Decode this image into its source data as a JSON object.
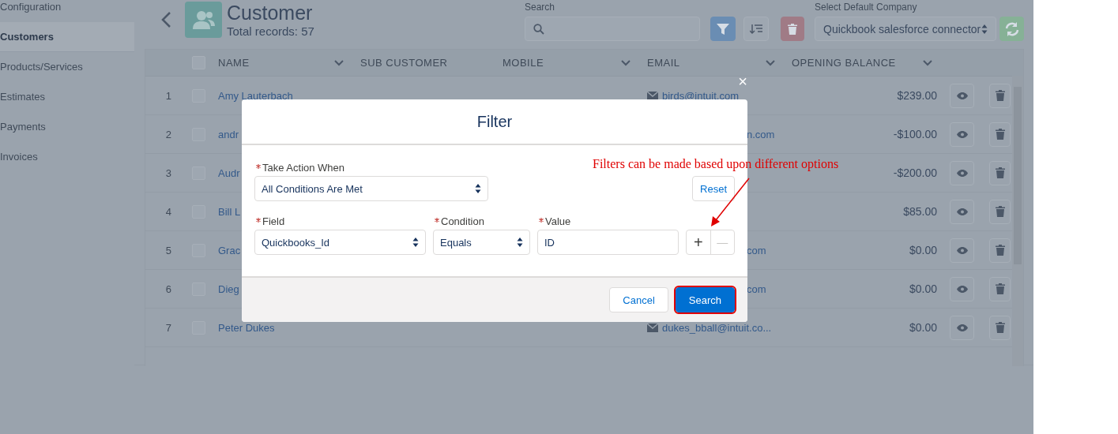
{
  "sidebar": {
    "items": [
      {
        "label": "Configuration",
        "selected": false
      },
      {
        "label": "Customers",
        "selected": true
      },
      {
        "label": "Products/Services",
        "selected": false
      },
      {
        "label": "Estimates",
        "selected": false
      },
      {
        "label": "Payments",
        "selected": false
      },
      {
        "label": "Invoices",
        "selected": false
      }
    ]
  },
  "header": {
    "title": "Customer",
    "subtitle": "Total records: 57",
    "search_label": "Search",
    "company_label": "Select Default Company",
    "company_value": "Quickbook salesforce connector"
  },
  "table": {
    "select_all_checked": false,
    "columns": [
      {
        "label": "NAME",
        "sortable": true
      },
      {
        "label": "SUB CUSTOMER",
        "sortable": false
      },
      {
        "label": "MOBILE",
        "sortable": true
      },
      {
        "label": "EMAIL",
        "sortable": true
      },
      {
        "label": "OPENING BALANCE",
        "sortable": true
      }
    ],
    "rows": [
      {
        "number": "1",
        "checked": false,
        "name": "Amy Lauterbach",
        "email": "birds@intuit.com",
        "email_cut": false,
        "balance": "$239.00"
      },
      {
        "number": "2",
        "checked": false,
        "name": "andr",
        "email": "n.com",
        "email_cut": true,
        "balance": "-$100.00"
      },
      {
        "number": "3",
        "checked": false,
        "name": "Audr",
        "balance": "-$200.00"
      },
      {
        "number": "4",
        "checked": false,
        "name": "Bill L",
        "balance": "$85.00"
      },
      {
        "number": "5",
        "checked": false,
        "name": "Grac",
        "email": "com",
        "email_cut": true,
        "balance": "$0.00"
      },
      {
        "number": "6",
        "checked": false,
        "name": "Dieg",
        "email": "com",
        "email_cut": true,
        "balance": "$0.00"
      },
      {
        "number": "7",
        "checked": false,
        "name": "Peter Dukes",
        "email": "dukes_bball@intuit.co...",
        "email_cut": false,
        "balance": "$0.00"
      }
    ]
  },
  "modal": {
    "title": "Filter",
    "close": "×",
    "action": {
      "label": "Take Action When",
      "required": true,
      "value": "All Conditions Are Met"
    },
    "reset": "Reset",
    "criteria": [
      {
        "label": "Field",
        "required": true,
        "kind": "select",
        "value": "Quickbooks_Id"
      },
      {
        "label": "Condition",
        "required": true,
        "kind": "select",
        "value": "Equals"
      },
      {
        "label": "Value",
        "required": true,
        "kind": "input",
        "value": "ID"
      }
    ],
    "add": {
      "label": "+",
      "disabled": false
    },
    "remove": {
      "label": "—",
      "disabled": true
    },
    "buttons": [
      {
        "label": "Cancel",
        "kind": "neutral",
        "highlighted": false
      },
      {
        "label": "Search",
        "kind": "brand",
        "highlighted": true
      }
    ]
  },
  "annotation": {
    "text": "Filters can be made based upon different options"
  }
}
